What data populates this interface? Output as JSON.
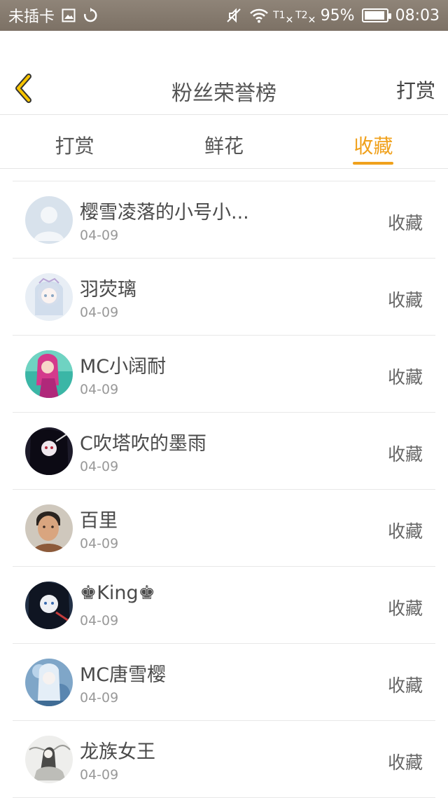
{
  "status_bar": {
    "carrier": "未插卡",
    "sim1": "T1",
    "sim2": "T2",
    "battery": "95%",
    "battery_level": 0.95,
    "time": "08:03"
  },
  "header": {
    "title": "粉丝荣誉榜",
    "right_action": "打赏"
  },
  "tabs": [
    {
      "label": "打赏",
      "active": false
    },
    {
      "label": "鲜花",
      "active": false
    },
    {
      "label": "收藏",
      "active": true
    }
  ],
  "accent_color": "#f0a11c",
  "fans": [
    {
      "name": "樱雪凌落的小号小...",
      "date": "04-09",
      "action": "收藏",
      "avatar": "default-avatar"
    },
    {
      "name": "羽荧璃",
      "date": "04-09",
      "action": "收藏",
      "avatar": "anime-avatar"
    },
    {
      "name": "MC小阔耐",
      "date": "04-09",
      "action": "收藏",
      "avatar": "anime-avatar"
    },
    {
      "name": "C吹塔吹的墨雨",
      "date": "04-09",
      "action": "收藏",
      "avatar": "anime-avatar"
    },
    {
      "name": "百里",
      "date": "04-09",
      "action": "收藏",
      "avatar": "photo-avatar"
    },
    {
      "name": "♚King♚",
      "date": "04-09",
      "action": "收藏",
      "avatar": "anime-avatar"
    },
    {
      "name": "MC唐雪樱",
      "date": "04-09",
      "action": "收藏",
      "avatar": "anime-avatar"
    },
    {
      "name": "龙族女王",
      "date": "04-09",
      "action": "收藏",
      "avatar": "ink-avatar"
    }
  ]
}
